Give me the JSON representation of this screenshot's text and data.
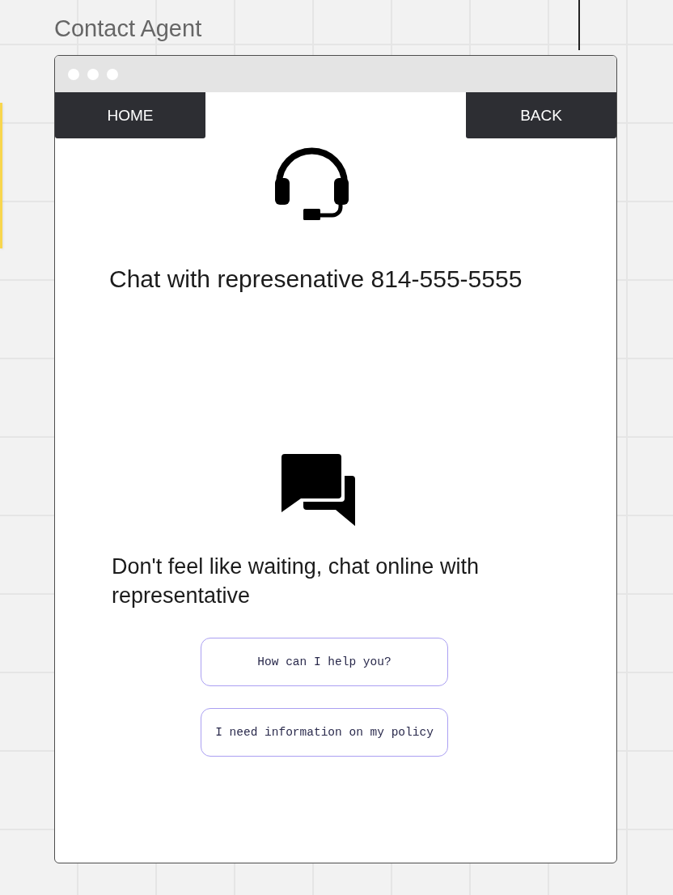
{
  "board_title": "Contact Agent",
  "nav_buttons": [
    {
      "label": "HOME"
    },
    {
      "label": "BACK"
    }
  ],
  "sections": [
    {
      "kind": "phone",
      "text": "Chat with represenative 814-555-5555"
    },
    {
      "kind": "chat",
      "text": "Don't feel like waiting, chat online with representative",
      "quick_replies": [
        {
          "label": "How can I help you?"
        },
        {
          "label": "I need information on my policy"
        }
      ]
    }
  ]
}
